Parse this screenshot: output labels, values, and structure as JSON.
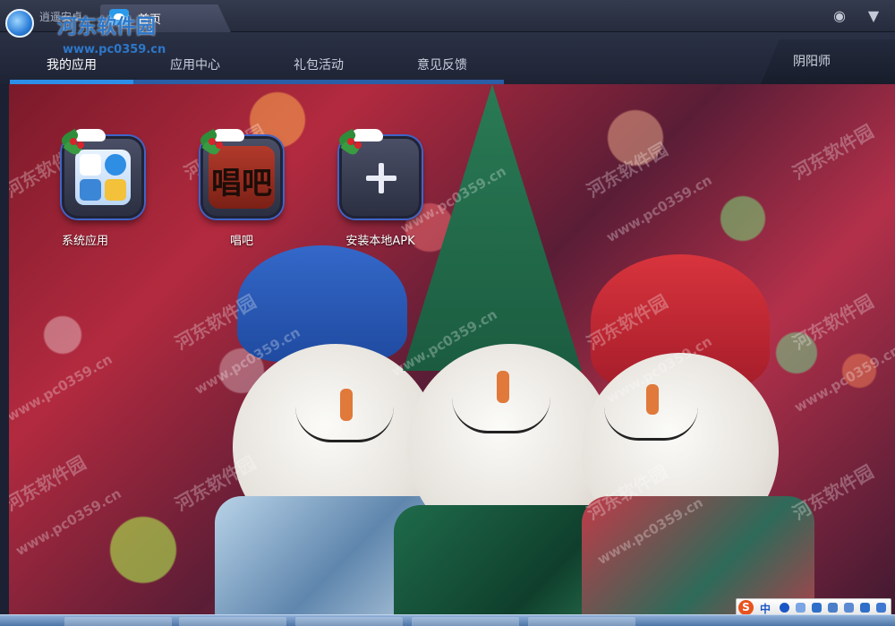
{
  "titlebar": {
    "app_name": "逍遥安卓",
    "home_tab": "首页",
    "icons": [
      "account-icon",
      "menu-dropdown-icon"
    ]
  },
  "nav": {
    "tabs": [
      {
        "label": "我的应用",
        "active": true
      },
      {
        "label": "应用中心",
        "active": false
      },
      {
        "label": "礼包活动",
        "active": false
      },
      {
        "label": "意见反馈",
        "active": false
      }
    ],
    "right_label": "阴阳师"
  },
  "apps": [
    {
      "label": "系统应用",
      "icon": "system-apps-icon"
    },
    {
      "label": "唱吧",
      "icon": "changba-icon",
      "glyph": "唱吧"
    },
    {
      "label": "安装本地APK",
      "icon": "install-apk-icon"
    }
  ],
  "watermark": {
    "text": "河东软件园",
    "url": "www.pc0359.cn"
  },
  "ime": {
    "logo": "S",
    "mode": "中"
  },
  "colors": {
    "accent": "#2c8ee8",
    "tab_bar": "#2a5ea6",
    "background": "#1b2133"
  }
}
